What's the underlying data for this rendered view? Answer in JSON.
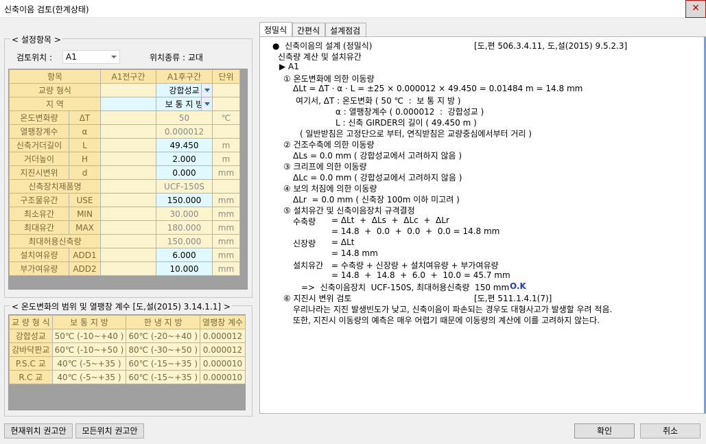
{
  "window": {
    "title": "신축이음 검토(한계상태)",
    "close_glyph": "✕"
  },
  "settings": {
    "group_title": "< 설정항목 >",
    "position_label": "검토위치 :",
    "position_value": "A1",
    "type_label": "위치종류 : 교대",
    "headers": [
      "항목",
      "",
      "A1전구간",
      "A1후구간",
      "단위"
    ],
    "rows": [
      {
        "name": "교량 형식",
        "sym": "",
        "before": "",
        "after": "강합성교",
        "unit": ""
      },
      {
        "name": "지   역",
        "sym": "",
        "before": "",
        "after": "보 통 지 방",
        "unit": ""
      },
      {
        "name": "온도변화량",
        "sym": "ΔT",
        "before": "",
        "after": "50",
        "unit": "℃"
      },
      {
        "name": "열팽창계수",
        "sym": "α",
        "before": "",
        "after": "0.000012",
        "unit": ""
      },
      {
        "name": "신축거더길이",
        "sym": "L",
        "before": "",
        "after": "49.450",
        "unit": "m"
      },
      {
        "name": "거더높이",
        "sym": "H",
        "before": "",
        "after": "2.000",
        "unit": "m"
      },
      {
        "name": "지진시변위",
        "sym": "d",
        "before": "",
        "after": "0.000",
        "unit": "mm"
      },
      {
        "name": "신축장치제품명",
        "sym": "",
        "before": "",
        "after": "UCF-150S",
        "unit": ""
      },
      {
        "name": "구조물유간",
        "sym": "USE",
        "before": "",
        "after": "150.000",
        "unit": "mm"
      },
      {
        "name": "최소유간",
        "sym": "MIN",
        "before": "",
        "after": "30.000",
        "unit": "mm"
      },
      {
        "name": "최대유간",
        "sym": "MAX",
        "before": "",
        "after": "180.000",
        "unit": "mm"
      },
      {
        "name": "최대허용신축량",
        "sym": "",
        "before": "",
        "after": "150.000",
        "unit": "mm"
      },
      {
        "name": "설치여유량",
        "sym": "ADD1",
        "before": "",
        "after": "6.000",
        "unit": "mm"
      },
      {
        "name": "부가여유량",
        "sym": "ADD2",
        "before": "",
        "after": "10.000",
        "unit": "mm"
      }
    ]
  },
  "temp": {
    "group_title": "< 온도변화의 범위 및 열팽창 계수 [도,설(2015) 3.14.1.1] >",
    "headers": [
      "교 량 형 식",
      "보 통 지 방",
      "한 냉 지 방",
      "열팽창 계수"
    ],
    "rows": [
      [
        "강합성교",
        "50℃ (-10~+40 )",
        "60℃ (-20~+40 )",
        "0.000012"
      ],
      [
        "강바닥판교",
        "60℃ (-10~+50 )",
        "80℃ (-30~+50 )",
        "0.000012"
      ],
      [
        "P.S.C 교",
        "40℃ (-5~+35 )",
        "60℃ (-15~+35 )",
        "0.000010"
      ],
      [
        "R.C 교",
        "40℃ (-5~+35 )",
        "60℃ (-15~+35 )",
        "0.000010"
      ]
    ]
  },
  "tabs": [
    "정밀식",
    "간편식",
    "설계점검"
  ],
  "report": {
    "l01": "●  신축이음의 설계 (정밀식)",
    "l01r": "[도,편 506.3.4.11, 도,설(2015) 9.5.2.3]",
    "l02": "신축량 계산 및 설치유간",
    "l03": "▶ A1",
    "l04": "① 온도변화에 의한 이동량",
    "l05": "ΔLt = ΔT · α · L = ±25 × 0.000012 × 49.450 = 0.01484 m = 14.8 mm",
    "l06": "여기서, ΔT : 온도변화 ( 50 ℃  :  보 통 지 방 )",
    "l07": "α : 열팽창계수 ( 0.000012  :  강합성교 )",
    "l08": "L : 신축 GIRDER의 길이 ( 49.450 m )",
    "l09": "( 일반받침은 고정단으로 부터, 연직받침은 교량중심에서부터 거리 )",
    "l10": "② 건조수축에 의한 이동량",
    "l11": "ΔLs = 0.0 mm ( 강합성교에서 고려하지 않음 )",
    "l12": "③ 크리프에 의한 이동량",
    "l13": "ΔLc = 0.0 mm ( 강합성교에서 고려하지 않음 )",
    "l14": "④ 보의 처짐에 의한 이동량",
    "l15": "ΔLr  = 0.0 mm ( 신축장 100m 이하 미고려 )",
    "l16": "⑤ 설치유간 및 신축이음장치 규격결정",
    "l17a": "수축량",
    "l17b": "= ΔLt  +  ΔLs  +  ΔLc  +  ΔLr",
    "l18": "= 14.8  +  0.0  +  0.0  +  0.0 = 14.8 mm",
    "l19a": "신장량",
    "l19b": "= ΔLt",
    "l20": "= 14.8 mm",
    "l21a": "설치유간",
    "l21b": "= 수축량 + 신장량 + 설치여유량 + 부가여유량",
    "l22": "= 14.8  +  14.8  +  6.0  +  10.0 = 45.7 mm",
    "l23": "=>  신축이음장치  UCF-150S, 최대허용신축량  150 mm",
    "l23ok": "O.K",
    "l24": "⑥ 지진시 변위 검토",
    "l24r": "[도,편 511.1.4.1(7)]",
    "l25": "우리나라는 지진 발생빈도가 낮고, 신축이음이 파손되는 경우도 대형사고가 발생할 우려 적음.",
    "l26": "또한, 지진시 이동량의 예측은 매우 어렵기 때문에 이동량의 계산에 이를 고려하지 않는다."
  },
  "buttons": {
    "current": "현재위치 권고안",
    "all": "모든위치 권고안",
    "ok": "확인",
    "cancel": "취소"
  }
}
